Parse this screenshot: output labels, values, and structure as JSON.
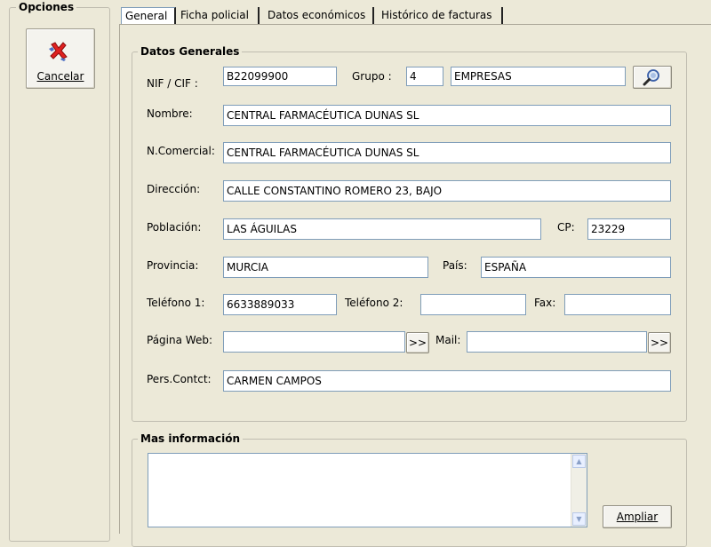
{
  "options": {
    "title": "Opciones",
    "cancel_label": "Cancelar"
  },
  "tabs": [
    {
      "label": "General"
    },
    {
      "label": "Ficha policial"
    },
    {
      "label": "Datos económicos"
    },
    {
      "label": "Histórico de facturas"
    }
  ],
  "general": {
    "section_title": "Datos Generales",
    "nif_label": "NIF / CIF :",
    "nif_value": "B22099900",
    "grupo_label": "Grupo :",
    "grupo_code": "4",
    "grupo_name": "EMPRESAS",
    "nombre_label": "Nombre:",
    "nombre_value": "CENTRAL FARMACÉUTICA DUNAS SL",
    "ncomercial_label": "N.Comercial:",
    "ncomercial_value": "CENTRAL FARMACÉUTICA DUNAS SL",
    "direccion_label": "Dirección:",
    "direccion_value": "CALLE CONSTANTINO ROMERO 23, BAJO",
    "poblacion_label": "Población:",
    "poblacion_value": "LAS ÁGUILAS",
    "cp_label": "CP:",
    "cp_value": "23229",
    "provincia_label": "Provincia:",
    "provincia_value": "MURCIA",
    "pais_label": "País:",
    "pais_value": "ESPAÑA",
    "telefono1_label": "Teléfono 1:",
    "telefono1_value": "6633889033",
    "telefono2_label": "Teléfono 2:",
    "telefono2_value": "",
    "fax_label": "Fax:",
    "fax_value": "",
    "web_label": "Página Web:",
    "web_value": "",
    "web_button": ">>",
    "mail_label": "Mail:",
    "mail_value": "",
    "mail_button": ">>",
    "contacto_label": "Pers.Contct:",
    "contacto_value": "CARMEN CAMPOS"
  },
  "more": {
    "section_title": "Mas información",
    "notes_value": "",
    "ampliar_label": "Ampliar"
  },
  "icons": {
    "cancel": "red-x-icon",
    "search": "magnifier-icon"
  }
}
